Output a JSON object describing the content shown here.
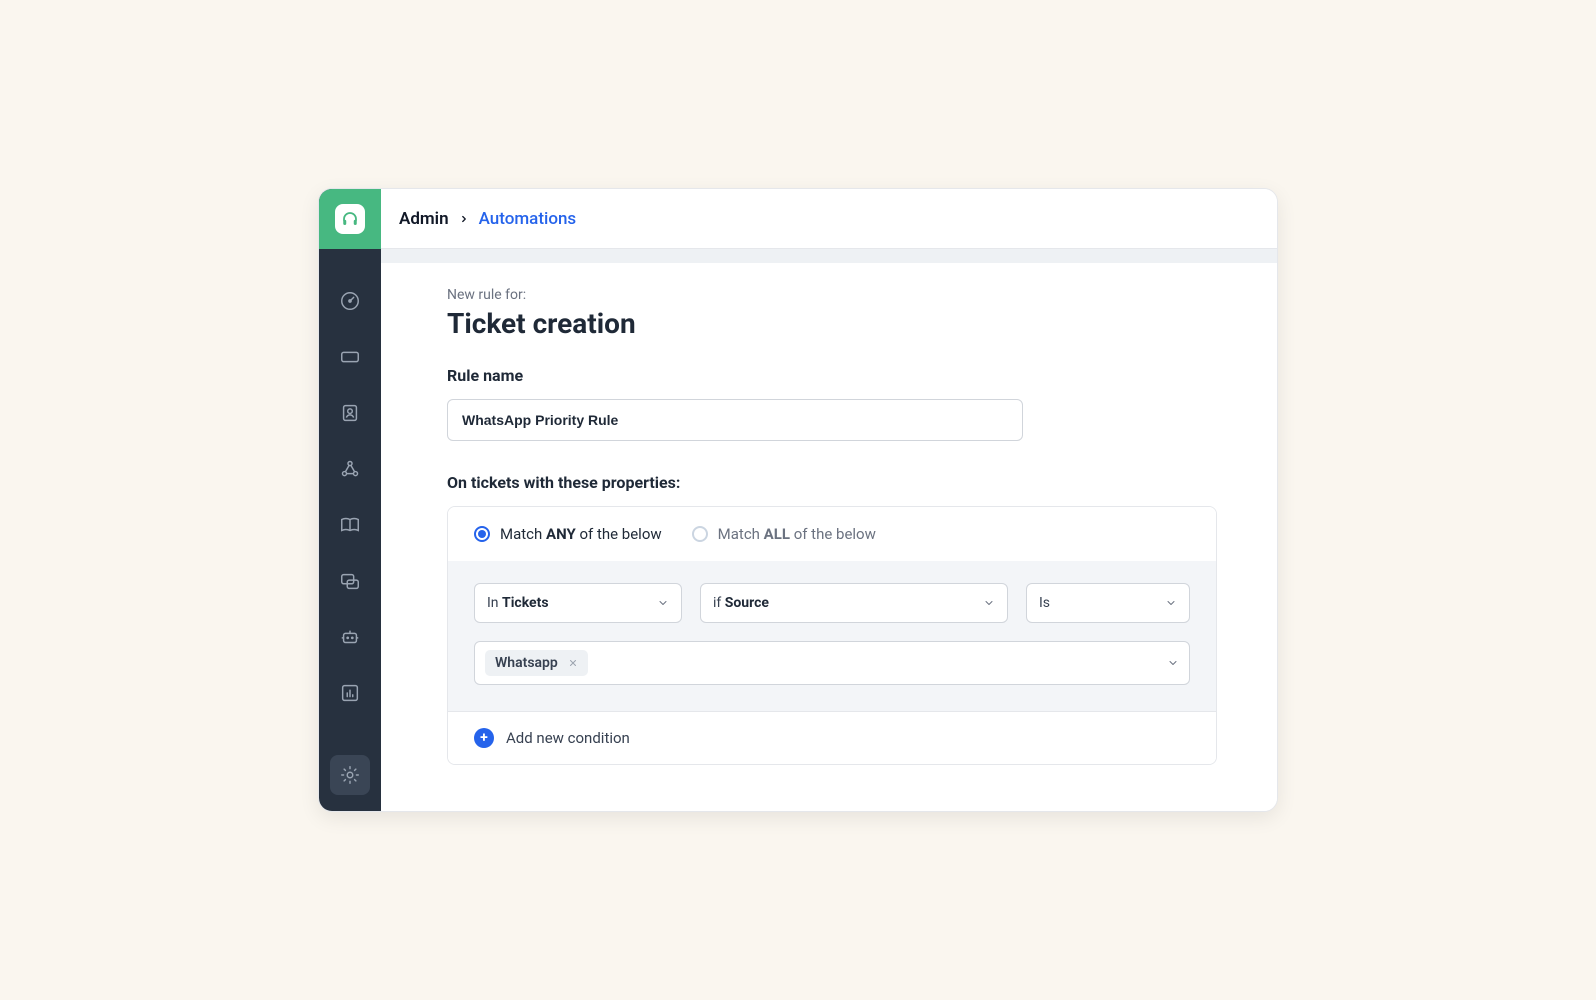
{
  "breadcrumb": {
    "root": "Admin",
    "current": "Automations"
  },
  "page": {
    "overline": "New rule for:",
    "title": "Ticket creation"
  },
  "ruleName": {
    "label": "Rule name",
    "value": "WhatsApp Priority Rule"
  },
  "properties": {
    "heading": "On tickets with these properties:",
    "matchAny": {
      "prefix": "Match ",
      "bold": "ANY",
      "suffix": " of the below"
    },
    "matchAll": {
      "prefix": "Match ",
      "bold": "ALL",
      "suffix": " of the below"
    }
  },
  "condition": {
    "select1": {
      "prefix": "In ",
      "bold": "Tickets"
    },
    "select2": {
      "prefix": "if ",
      "bold": "Source"
    },
    "select3": {
      "text": "Is"
    },
    "tag": "Whatsapp"
  },
  "addCondition": "Add new condition"
}
